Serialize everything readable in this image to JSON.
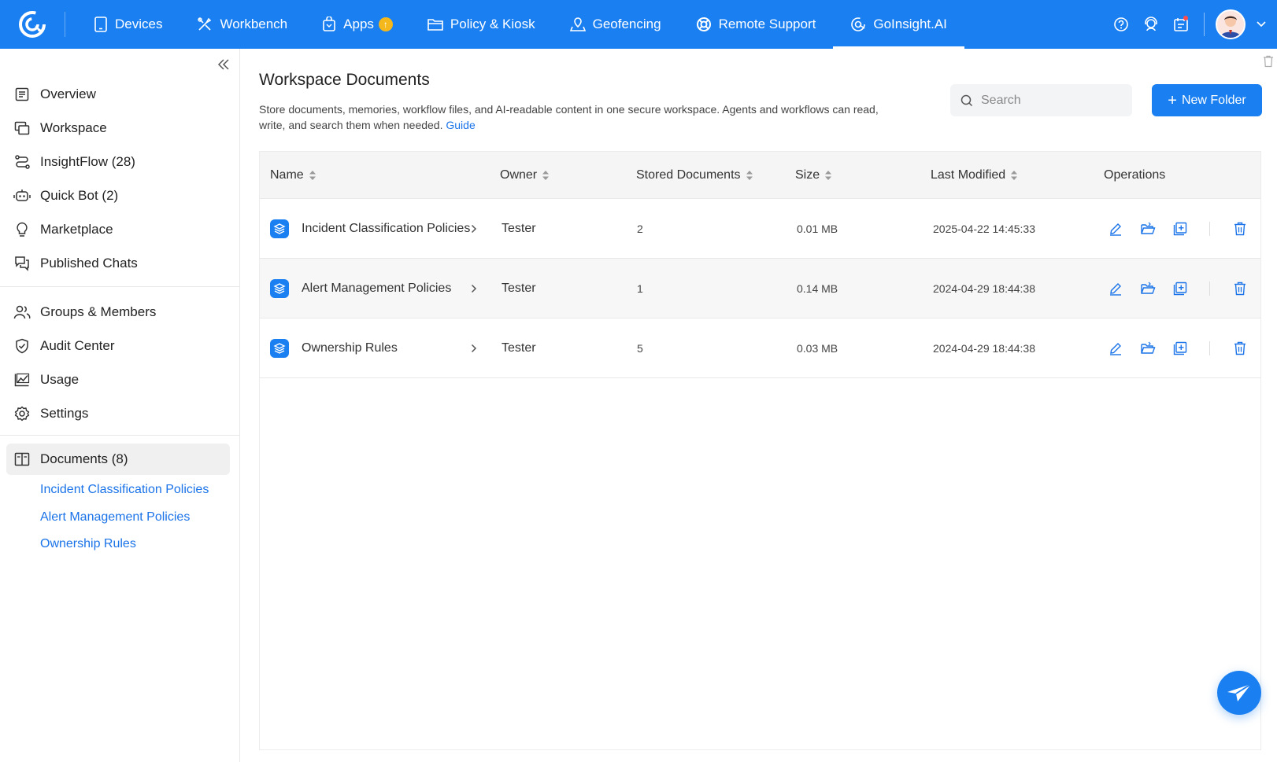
{
  "nav": {
    "items": [
      {
        "label": "Devices",
        "icon": "tablet-icon"
      },
      {
        "label": "Workbench",
        "icon": "tools-icon"
      },
      {
        "label": "Apps",
        "icon": "shopping-bag-icon",
        "badge": "↑"
      },
      {
        "label": "Policy & Kiosk",
        "icon": "folder-icon"
      },
      {
        "label": "Geofencing",
        "icon": "location-icon"
      },
      {
        "label": "Remote Support",
        "icon": "lifebuoy-icon"
      },
      {
        "label": "GoInsight.AI",
        "icon": "ai-icon",
        "active": true
      }
    ],
    "accent": "#1a7ff0"
  },
  "sidebar": {
    "items": [
      {
        "label": "Overview",
        "icon": "list-icon"
      },
      {
        "label": "Workspace",
        "icon": "workspace-icon"
      },
      {
        "label": "InsightFlow (28)",
        "icon": "flow-icon"
      },
      {
        "label": "Quick Bot (2)",
        "icon": "bot-icon"
      },
      {
        "label": "Marketplace",
        "icon": "lightbulb-icon"
      },
      {
        "label": "Published Chats",
        "icon": "chat-icon"
      },
      {
        "label": "Groups & Members",
        "icon": "users-icon"
      },
      {
        "label": "Audit Center",
        "icon": "shield-icon"
      },
      {
        "label": "Usage",
        "icon": "chart-icon"
      },
      {
        "label": "Settings",
        "icon": "gear-icon"
      }
    ],
    "documents": {
      "label": "Documents (8)",
      "children": [
        "Incident Classification Policies",
        "Alert Management Policies",
        "Ownership Rules"
      ]
    }
  },
  "main": {
    "title": "Workspace Documents",
    "description": "Store documents, memories, workflow files, and AI-readable content in one secure workspace. Agents and workflows can read, write, and search them when needed.",
    "guide_link": "Guide",
    "search_placeholder": "Search",
    "new_folder_label": "New Folder"
  },
  "table": {
    "columns": [
      "Name",
      "Owner",
      "Stored Documents",
      "Size",
      "Last Modified",
      "Operations"
    ],
    "rows": [
      {
        "name": "Incident Classification Policies",
        "owner": "Tester",
        "stored": "2",
        "size": "0.01 MB",
        "modified": "2025-04-22 14:45:33"
      },
      {
        "name": "Alert Management Policies",
        "owner": "Tester",
        "stored": "1",
        "size": "0.14 MB",
        "modified": "2024-04-29 18:44:38"
      },
      {
        "name": "Ownership Rules",
        "owner": "Tester",
        "stored": "5",
        "size": "0.03 MB",
        "modified": "2024-04-29 18:44:38"
      }
    ]
  }
}
